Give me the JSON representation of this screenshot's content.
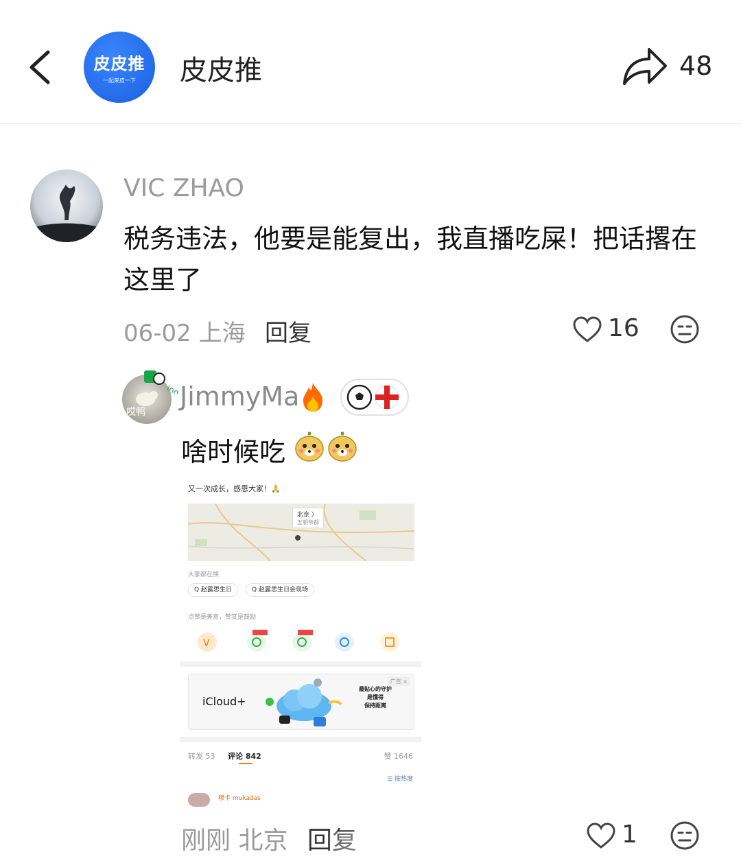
{
  "header": {
    "channel_avatar_text": "皮皮推",
    "channel_avatar_subtext": "一起来皮一下",
    "channel_name": "皮皮推",
    "share_count": "48"
  },
  "comment": {
    "author": "VIC ZHAO",
    "text": "税务违法，他要是能复出，我直播吃屎！把话撂在这里了",
    "date_location": "06-02 上海",
    "reply_label": "回复",
    "likes": "16"
  },
  "sub_comment": {
    "avatar_tag": "哎鸭",
    "author": "JimmyMa",
    "text": "啥时候吃",
    "date_location": "刚刚 北京",
    "reply_label": "回复",
    "likes": "1"
  },
  "screenshot": {
    "title": "又一次成长，感恩大家！🙏",
    "map_pin_city": "北京 〉",
    "map_pin_sub": "五朝帝都",
    "search_label": "大家都在搜",
    "chip1": "Q 赵露思生日",
    "chip2": "Q 赵露思生日会现场",
    "praise_label": "点赞是美意，赞赏是鼓励",
    "ad_brand": "iCloud+",
    "ad_tag": "广告 ×",
    "ad_slogan_1": "最贴心的守护",
    "ad_slogan_2": "是懂得",
    "ad_slogan_3": "保持距离",
    "tab_repost": "转发 53",
    "tab_comment": "评论 842",
    "tab_likes": "赞 1646",
    "sort_label": "☰ 按热度",
    "first_user": "穆卡 mukadas"
  },
  "colors": {
    "brand_blue": "#1a5fe0",
    "text_gray": "#9a9a9a",
    "accent_orange": "#ff8200"
  }
}
